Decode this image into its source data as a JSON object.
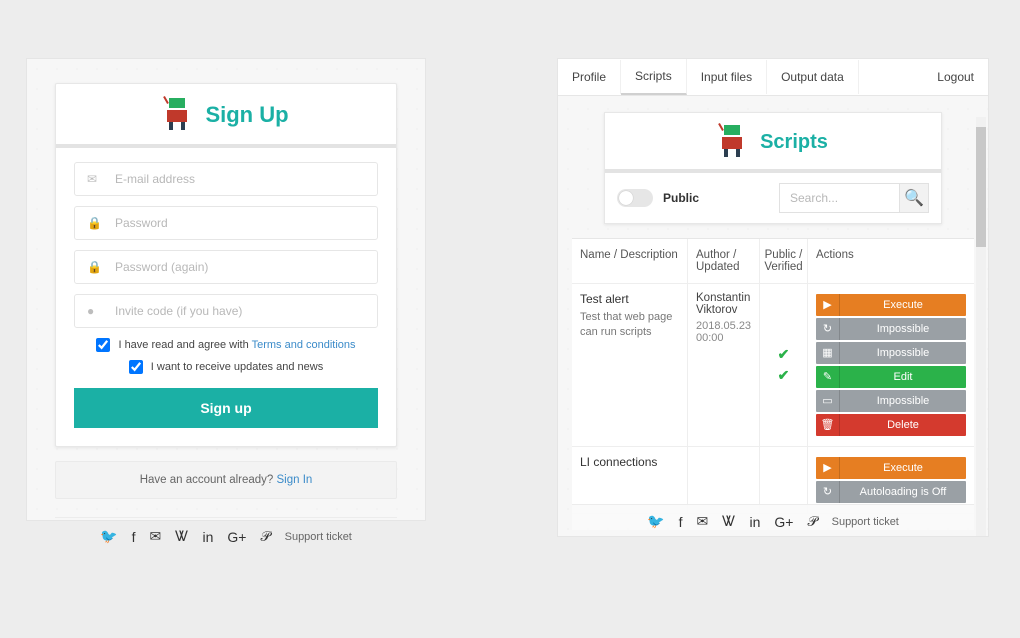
{
  "signup": {
    "title": "Sign Up",
    "email_ph": "E-mail address",
    "pw_ph": "Password",
    "pw2_ph": "Password (again)",
    "invite_ph": "Invite code (if you have)",
    "agree_text": "I have read and agree with ",
    "terms_link": "Terms and conditions",
    "news_text": "I want to receive updates and news",
    "submit": "Sign up",
    "have_account": "Have an account already? ",
    "signin": "Sign In",
    "support": "Support ticket"
  },
  "right": {
    "tabs": {
      "profile": "Profile",
      "scripts": "Scripts",
      "input": "Input files",
      "output": "Output data",
      "logout": "Logout"
    },
    "title": "Scripts",
    "toggle_label": "Public",
    "search_ph": "Search...",
    "headers": {
      "name": "Name / Description",
      "author": "Author / Updated",
      "pub": "Public / Verified",
      "actions": "Actions"
    },
    "rows": [
      {
        "name": "Test alert",
        "desc": "Test that web page can run scripts",
        "author": "Konstantin Viktorov",
        "updated": "2018.05.23 00:00",
        "actions": [
          {
            "label": "Execute",
            "color": "orange",
            "icon": "▶"
          },
          {
            "label": "Impossible",
            "color": "gray",
            "icon": "↻"
          },
          {
            "label": "Impossible",
            "color": "gray",
            "icon": "▦"
          },
          {
            "label": "Edit",
            "color": "green",
            "icon": "✎"
          },
          {
            "label": "Impossible",
            "color": "gray",
            "icon": "▭"
          },
          {
            "label": "Delete",
            "color": "red",
            "icon": "🗑"
          }
        ]
      },
      {
        "name": "LI connections",
        "desc": "",
        "author": "",
        "updated": "",
        "actions": [
          {
            "label": "Execute",
            "color": "orange",
            "icon": "▶"
          },
          {
            "label": "Autoloading is Off",
            "color": "gray",
            "icon": "↻"
          }
        ]
      }
    ],
    "support": "Support ticket"
  },
  "social_icons": [
    "twitter",
    "facebook",
    "mail",
    "vk",
    "linkedin",
    "gplus",
    "pinterest"
  ]
}
